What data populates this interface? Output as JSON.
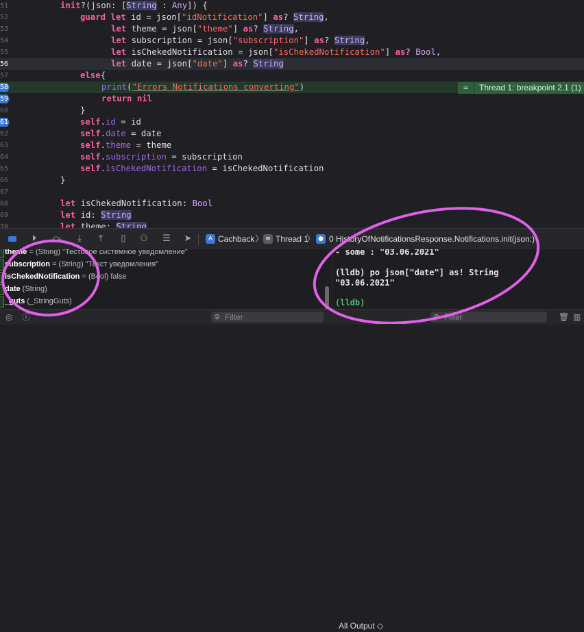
{
  "editor": {
    "gutter": [
      "51",
      "52",
      "53",
      "54",
      "55",
      "56",
      "57",
      "58",
      "59",
      "60",
      "61",
      "62",
      "63",
      "64",
      "65",
      "66",
      "67",
      "68",
      "69",
      "70"
    ]
  },
  "breakpoint_badge": {
    "icon": "equals-icon",
    "text": "Thread 1: breakpoint 2.1 (1)"
  },
  "debug_bar": {
    "crumbs": [
      "Cachback",
      "Thread 1",
      "0 HistoryOfNotificationsResponse.Notifications.init(json:)"
    ]
  },
  "variables": [
    {
      "name": "theme",
      "detail": " = (String) \"Тестовое системное уведомление\""
    },
    {
      "name": "subscription",
      "detail": " = (String) \"Текст уведомления\""
    },
    {
      "name": "isChekedNotification",
      "detail": " = (Bool) false"
    },
    {
      "name": "date",
      "detail": " (String)"
    },
    {
      "name": "_guts",
      "detail": " (_StringGuts)"
    }
  ],
  "console": [
    "- some : \"03.06.2021\"",
    "",
    "(lldb) po json[\"date\"] as! String",
    "\"03.06.2021\"",
    "",
    "(lldb)"
  ],
  "filter_bar": {
    "vars_filter_placeholder": "Filter",
    "console_filter_placeholder": "Filter",
    "output_selector": "All Output ◇"
  },
  "colors": {
    "annotation": "#e060e8",
    "breakpoint": "#3b79d8",
    "lldb": "#4fb86b"
  }
}
